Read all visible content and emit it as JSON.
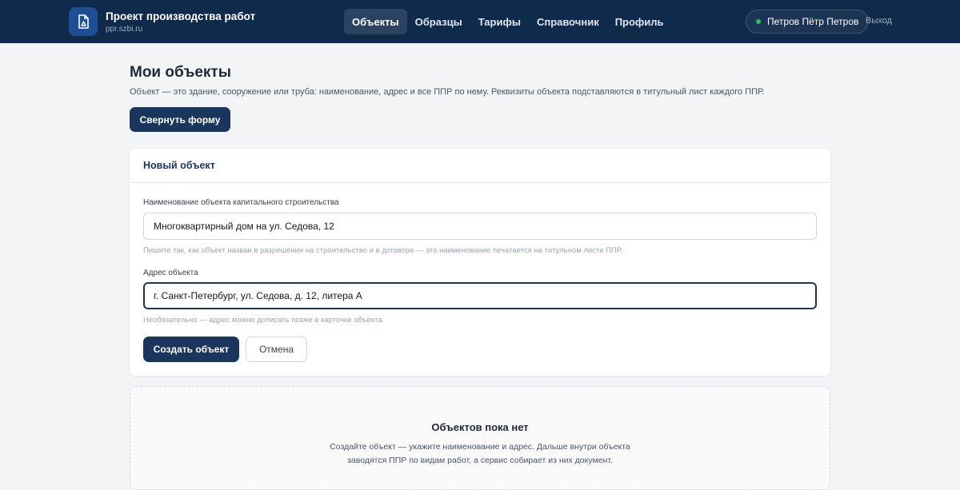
{
  "header": {
    "app_title": "Проект производства работ",
    "app_subtitle": "ppr.szbi.ru",
    "nav": [
      {
        "label": "Объекты",
        "active": true
      },
      {
        "label": "Образцы"
      },
      {
        "label": "Тарифы"
      },
      {
        "label": "Справочник"
      },
      {
        "label": "Профиль"
      }
    ],
    "user_name": "Петров Пётр Петров",
    "logout_label": "Выход"
  },
  "page": {
    "title": "Мои объекты",
    "description": "Объект — это здание, сооружение или труба: наименование, адрес и все ППР по нему. Реквизиты объекта подставляются в титульный лист каждого ППР.",
    "collapse_label": "Свернуть форму"
  },
  "form": {
    "title": "Новый объект",
    "name_label": "Наименование объекта капитального строительства",
    "name_value": "Многоквартирный дом на ул. Седова, 12",
    "name_hint": "Пишите так, как объект назван в разрешении на строительство и в договоре — это наименование печатается на титульном листе ППР.",
    "address_label": "Адрес объекта",
    "address_value": "г. Санкт-Петербург, ул. Седова, д. 12, литера А",
    "address_hint": "Необязательно — адрес можно дописать позже в карточке объекта.",
    "create_label": "Создать объект",
    "cancel_label": "Отмена"
  },
  "empty_state": {
    "title": "Объектов пока нет",
    "line1": "Создайте объект — укажите наименование и адрес. Дальше внутри объекта",
    "line2": "заводятся ППР по видам работ, а сервис собирает из них документ."
  },
  "colors": {
    "header_bg": "#0f2a4a",
    "primary": "#1b365d",
    "status_online": "#22c55e"
  }
}
